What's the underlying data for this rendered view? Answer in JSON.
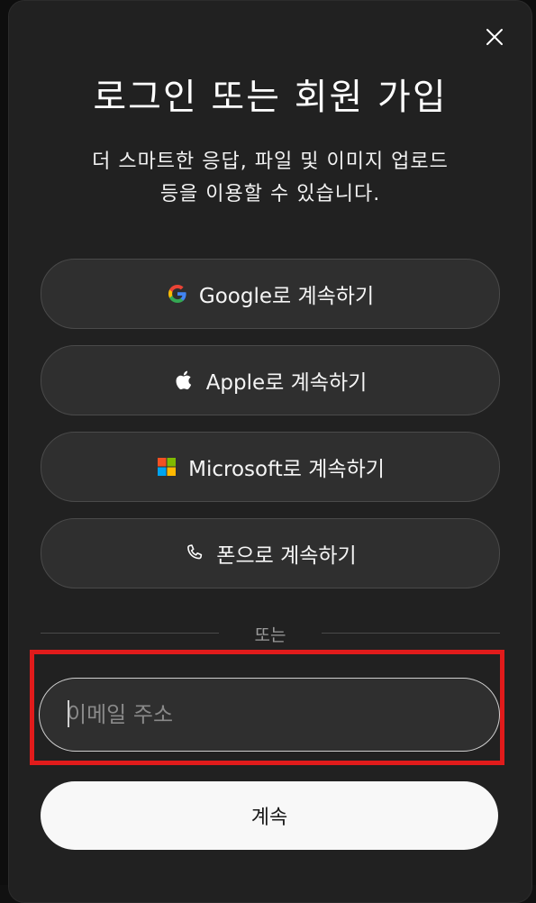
{
  "dialog": {
    "title": "로그인 또는 회원 가입",
    "subtitle_line1": "더 스마트한 응답, 파일 및 이미지 업로드",
    "subtitle_line2": "등을 이용할 수 있습니다.",
    "close_icon": "close-icon"
  },
  "sso": [
    {
      "label": "Google로 계속하기",
      "icon": "google-icon"
    },
    {
      "label": "Apple로 계속하기",
      "icon": "apple-icon"
    },
    {
      "label": "Microsoft로 계속하기",
      "icon": "microsoft-icon"
    },
    {
      "label": "폰으로 계속하기",
      "icon": "phone-icon"
    }
  ],
  "divider_text": "또는",
  "email": {
    "placeholder": "이메일 주소",
    "value": ""
  },
  "continue_label": "계속",
  "colors": {
    "modal_bg": "#212121",
    "button_bg": "#2f2f2f",
    "highlight": "#e11b1b",
    "primary_button": "#f8f8f8"
  }
}
